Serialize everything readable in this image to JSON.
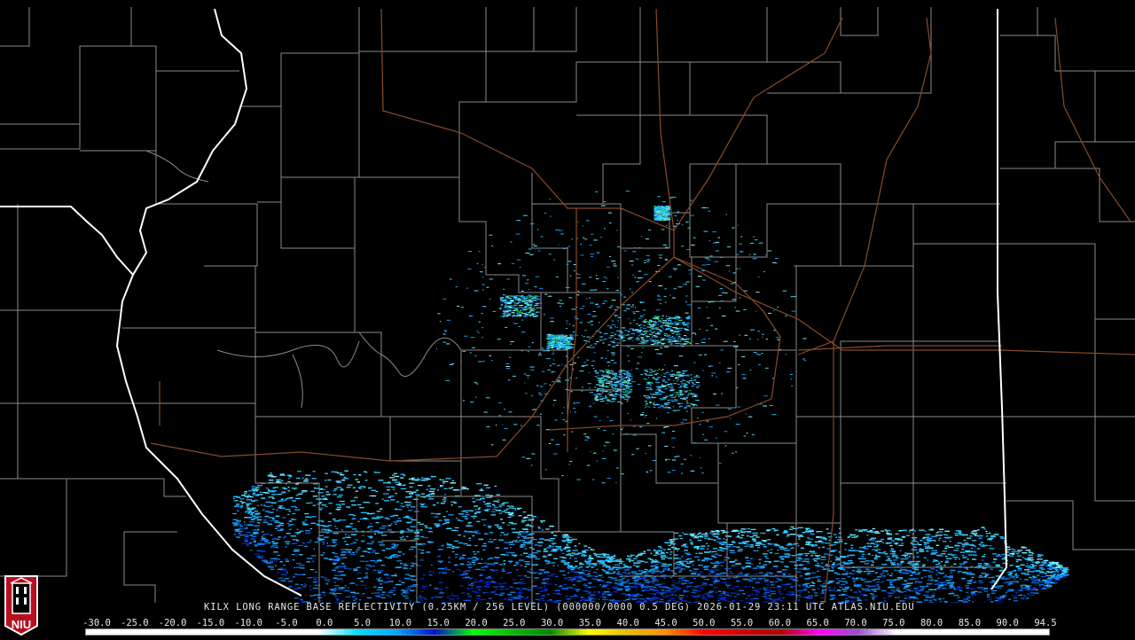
{
  "caption": "KILX LONG RANGE BASE REFLECTIVITY (0.25KM / 256 LEVEL) (000000/0000 0.5 DEG) 2026-01-29 23:11 UTC  ATLAS.NIU.EDU",
  "logo": {
    "text": "NIU",
    "icon": "university-tower-icon",
    "background": "#b80f1f"
  },
  "colors": {
    "county_border": "#8a8a8a",
    "state_border": "#ffffff",
    "highway": "#8a4a2a",
    "background": "#000000"
  },
  "color_scale": {
    "labels": [
      "-30.0",
      "-25.0",
      "-20.0",
      "-15.0",
      "-10.0",
      "-5.0",
      "0.0",
      "5.0",
      "10.0",
      "15.0",
      "20.0",
      "25.0",
      "30.0",
      "35.0",
      "40.0",
      "45.0",
      "50.0",
      "55.0",
      "60.0",
      "65.0",
      "70.0",
      "75.0",
      "80.0",
      "85.0",
      "90.0",
      "94.5"
    ],
    "stops": [
      {
        "value": -30,
        "color": "#ffffff"
      },
      {
        "value": 0,
        "color": "#ffffff"
      },
      {
        "value": 5,
        "color": "#00e0ff"
      },
      {
        "value": 10,
        "color": "#00a8ff"
      },
      {
        "value": 15,
        "color": "#0010d0"
      },
      {
        "value": 20,
        "color": "#00ff00"
      },
      {
        "value": 25,
        "color": "#00c000"
      },
      {
        "value": 30,
        "color": "#008800"
      },
      {
        "value": 35,
        "color": "#ffff00"
      },
      {
        "value": 40,
        "color": "#e8c000"
      },
      {
        "value": 45,
        "color": "#ff8c00"
      },
      {
        "value": 50,
        "color": "#ff0000"
      },
      {
        "value": 55,
        "color": "#d00000"
      },
      {
        "value": 60,
        "color": "#b00000"
      },
      {
        "value": 65,
        "color": "#ff00ff"
      },
      {
        "value": 70,
        "color": "#9a50d0"
      },
      {
        "value": 75,
        "color": "#ffffff"
      },
      {
        "value": 94.5,
        "color": "#ffffff"
      }
    ]
  }
}
